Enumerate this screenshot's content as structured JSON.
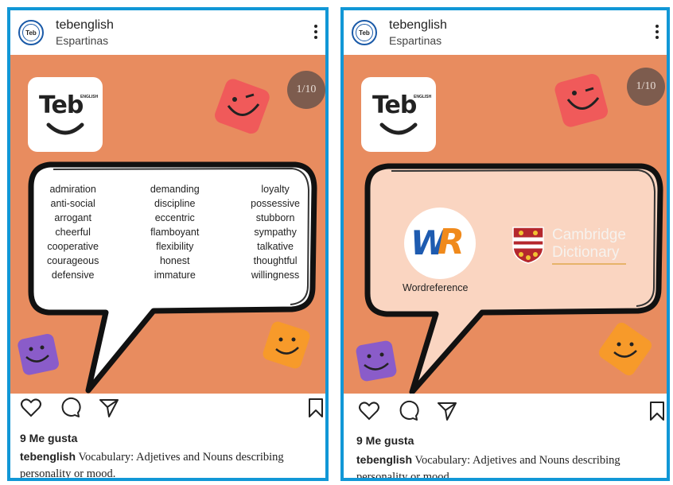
{
  "posts": [
    {
      "username": "tebenglish",
      "location": "Espartinas",
      "logo_text": "Teb",
      "logo_small": "ENGLISH",
      "counter": "1/10",
      "words": [
        [
          "admiration",
          "anti-social",
          "arrogant",
          "cheerful",
          "cooperative",
          "courageous",
          "defensive"
        ],
        [
          "demanding",
          "discipline",
          "eccentric",
          "flamboyant",
          "flexibility",
          "honest",
          "immature"
        ],
        [
          "loyalty",
          "possessive",
          "stubborn",
          "sympathy",
          "talkative",
          "thoughtful",
          "willingness"
        ]
      ],
      "likes": "9 Me gusta",
      "caption_user": "tebenglish",
      "caption_text": " Vocabulary: Adjetives and Nouns describing personality or mood."
    },
    {
      "username": "tebenglish",
      "location": "Espartinas",
      "logo_text": "Teb",
      "logo_small": "ENGLISH",
      "counter": "1/10",
      "wr_w": "W",
      "wr_r": "R",
      "wr_label": "Wordreference",
      "cambridge_line1": "Cambridge",
      "cambridge_line2": "Dictionary",
      "likes": "9 Me gusta",
      "caption_user": "tebenglish",
      "caption_text": " Vocabulary: Adjetives and Nouns describing personality or mood."
    }
  ],
  "colors": {
    "border": "#1197d6",
    "post_bg": "#e88c5f",
    "red_square": "#f05a5a",
    "purple_square": "#8a5cc9",
    "orange_square": "#f79a2a",
    "counter_bg": "#7d5c4e"
  },
  "icons": [
    "heart-icon",
    "comment-icon",
    "share-icon",
    "bookmark-icon",
    "more-icon"
  ]
}
